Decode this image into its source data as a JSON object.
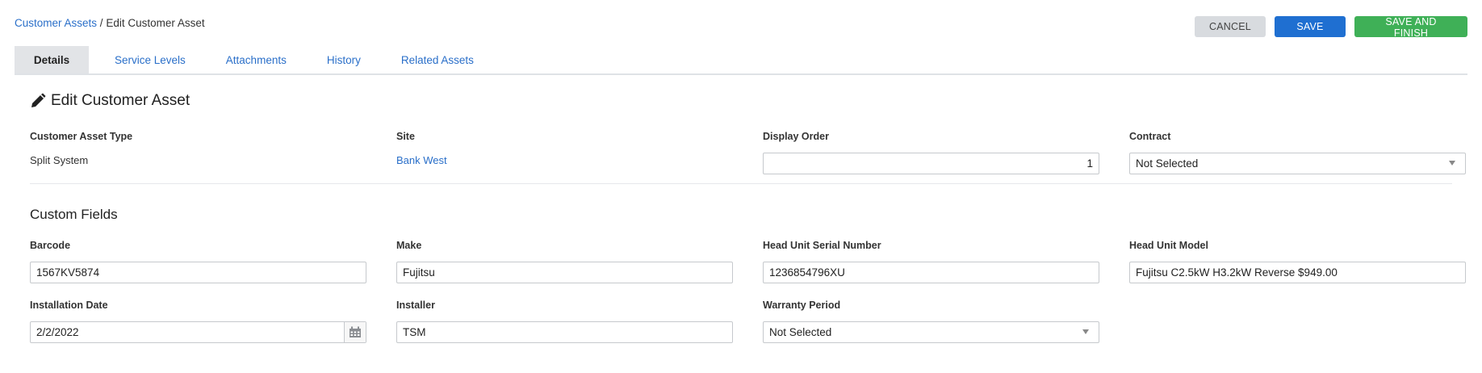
{
  "breadcrumb": {
    "parent": "Customer Assets",
    "separator": " / ",
    "current": "Edit Customer Asset"
  },
  "actions": {
    "cancel": "CANCEL",
    "save": "SAVE",
    "save_finish": "SAVE AND FINISH"
  },
  "tabs": [
    "Details",
    "Service Levels",
    "Attachments",
    "History",
    "Related Assets"
  ],
  "page_title": "Edit Customer Asset",
  "details": {
    "asset_type_label": "Customer Asset Type",
    "asset_type_value": "Split System",
    "site_label": "Site",
    "site_value": "Bank West",
    "display_order_label": "Display Order",
    "display_order_value": "1",
    "contract_label": "Contract",
    "contract_value": "Not Selected"
  },
  "custom_fields": {
    "title": "Custom Fields",
    "barcode_label": "Barcode",
    "barcode_value": "1567KV5874",
    "make_label": "Make",
    "make_value": "Fujitsu",
    "serial_label": "Head Unit Serial Number",
    "serial_value": "1236854796XU",
    "model_label": "Head Unit Model",
    "model_value": "Fujitsu C2.5kW H3.2kW Reverse $949.00",
    "install_date_label": "Installation Date",
    "install_date_value": "2/2/2022",
    "installer_label": "Installer",
    "installer_value": "TSM",
    "warranty_label": "Warranty Period",
    "warranty_value": "Not Selected"
  },
  "colors": {
    "link": "#2a6fc9",
    "save": "#1f6fd1",
    "finish": "#3fb057",
    "cancel": "#d8dbdf"
  }
}
